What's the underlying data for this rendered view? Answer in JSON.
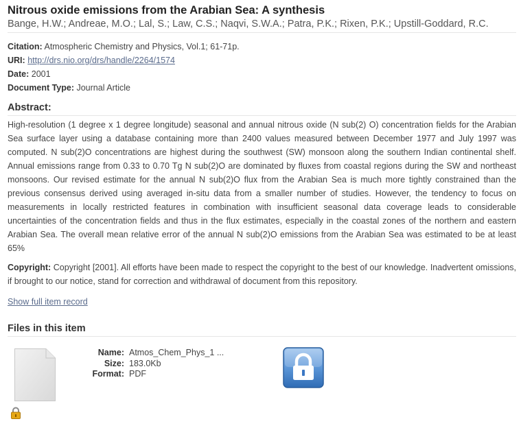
{
  "item": {
    "title": "Nitrous oxide emissions from the Arabian Sea: A synthesis",
    "authors": "Bange, H.W.; Andreae, M.O.; Lal, S.; Law, C.S.; Naqvi, S.W.A.; Patra, P.K.; Rixen, P.K.; Upstill-Goddard, R.C."
  },
  "metadata": {
    "citation_label": "Citation:",
    "citation_value": "Atmospheric Chemistry and Physics, Vol.1; 61-71p.",
    "uri_label": "URI:",
    "uri_value": "http://drs.nio.org/drs/handle/2264/1574",
    "date_label": "Date:",
    "date_value": "2001",
    "doctype_label": "Document Type:",
    "doctype_value": "Journal Article"
  },
  "abstract": {
    "heading": "Abstract:",
    "text": "High-resolution (1 degree x 1 degree longitude) seasonal and annual nitrous oxide (N sub(2) O) concentration fields for the Arabian Sea surface layer using a database containing more than 2400 values measured between December 1977 and July 1997 was computed. N sub(2)O concentrations are highest during the southwest (SW) monsoon along the southern Indian continental shelf. Annual emissions range from 0.33 to 0.70 Tg N sub(2)O are dominated by fluxes from coastal regions during the SW and northeast monsoons. Our revised estimate for the annual N sub(2)O flux from the Arabian Sea is much more tightly constrained than the previous consensus derived using averaged in-situ data from a smaller number of studies. However, the tendency to focus on measurements in locally restricted features in combination with insufficient seasonal data coverage leads to considerable uncertainties of the concentration fields and thus in the flux estimates, especially in the coastal zones of the northern and eastern Arabian Sea. The overall mean relative error of the annual N sub(2)O emissions from the Arabian Sea was estimated to be at least 65%"
  },
  "copyright": {
    "label": "Copyright:",
    "text": "Copyright [2001]. All efforts have been made to respect the copyright to the best of our knowledge. Inadvertent omissions, if brought to our notice, stand for correction and withdrawal of document from this repository."
  },
  "links": {
    "full_record": "Show full item record"
  },
  "files": {
    "heading": "Files in this item",
    "name_label": "Name:",
    "name_value": "Atmos_Chem_Phys_1 ...",
    "size_label": "Size:",
    "size_value": "183.0Kb",
    "format_label": "Format:",
    "format_value": "PDF",
    "thumbnail_icon": "document-thumbnail-icon",
    "small_lock_icon": "padlock-icon",
    "big_lock_icon": "restricted-access-lock-icon"
  },
  "colors": {
    "link": "#5a6b8c",
    "lock_blue": "#3b78c4"
  }
}
